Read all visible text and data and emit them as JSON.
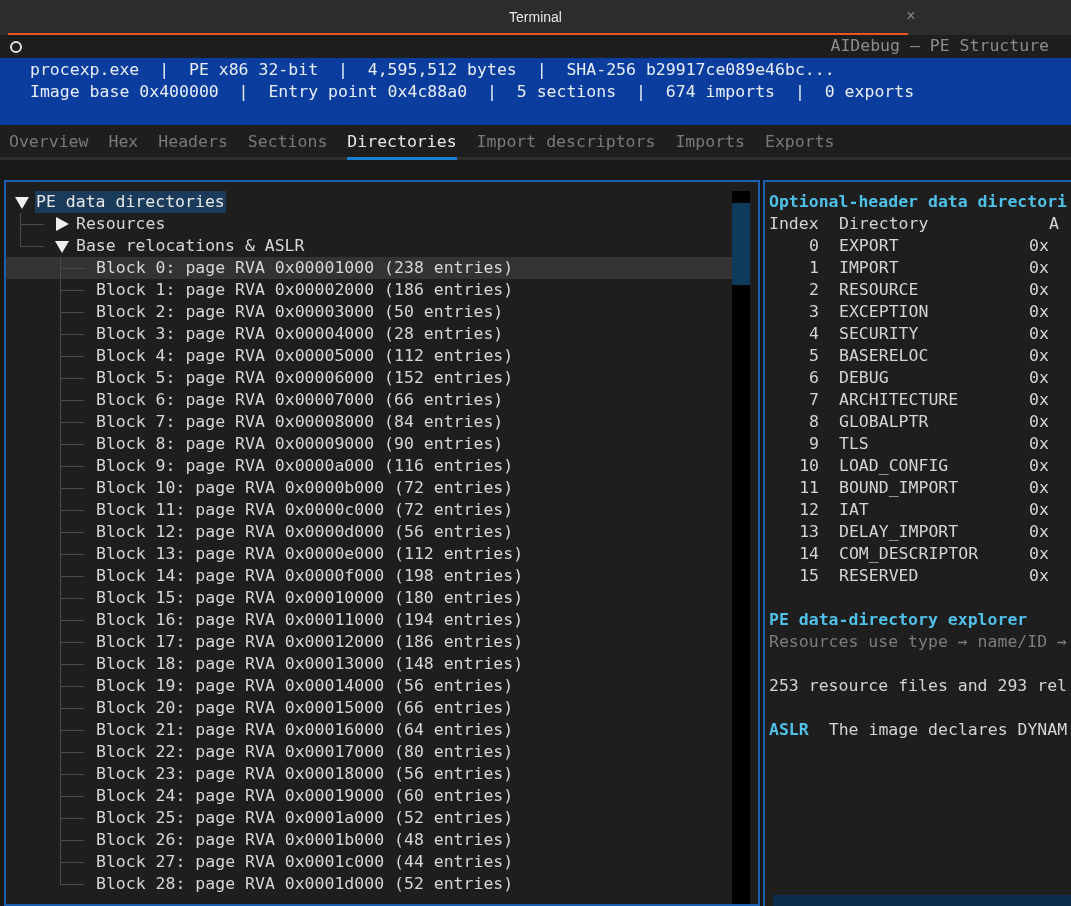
{
  "window": {
    "title": "Terminal",
    "close": "×"
  },
  "app_title": "AIDebug — PE Structure",
  "summary": [
    "procexp.exe  |  PE x86 32-bit  |  4,595,512 bytes  |  SHA-256 b29917ce089e46bc...",
    "Image base 0x400000  |  Entry point 0x4c88a0  |  5 sections  |  674 imports  |  0 exports"
  ],
  "tabs": [
    {
      "label": "Overview",
      "selected": false
    },
    {
      "label": "Hex",
      "selected": false
    },
    {
      "label": "Headers",
      "selected": false
    },
    {
      "label": "Sections",
      "selected": false
    },
    {
      "label": "Directories",
      "selected": true
    },
    {
      "label": "Import descriptors",
      "selected": false
    },
    {
      "label": "Imports",
      "selected": false
    },
    {
      "label": "Exports",
      "selected": false
    }
  ],
  "tree": {
    "label": "PE data directories",
    "expanded": true,
    "selected": true,
    "children": [
      {
        "label": "Resources",
        "expanded": false,
        "selected": false
      },
      {
        "label": "Base relocations & ASLR",
        "expanded": true,
        "selected": false,
        "children": [
          {
            "label": "Block 0: page RVA 0x00001000 (238 entries)",
            "selected": false,
            "hovered": true
          },
          {
            "label": "Block 1: page RVA 0x00002000 (186 entries)",
            "selected": false,
            "hovered": false
          },
          {
            "label": "Block 2: page RVA 0x00003000 (50 entries)",
            "selected": false,
            "hovered": false
          },
          {
            "label": "Block 3: page RVA 0x00004000 (28 entries)",
            "selected": false,
            "hovered": false
          },
          {
            "label": "Block 4: page RVA 0x00005000 (112 entries)",
            "selected": false,
            "hovered": false
          },
          {
            "label": "Block 5: page RVA 0x00006000 (152 entries)",
            "selected": false,
            "hovered": false
          },
          {
            "label": "Block 6: page RVA 0x00007000 (66 entries)",
            "selected": false,
            "hovered": false
          },
          {
            "label": "Block 7: page RVA 0x00008000 (84 entries)",
            "selected": false,
            "hovered": false
          },
          {
            "label": "Block 8: page RVA 0x00009000 (90 entries)",
            "selected": false,
            "hovered": false
          },
          {
            "label": "Block 9: page RVA 0x0000a000 (116 entries)",
            "selected": false,
            "hovered": false
          },
          {
            "label": "Block 10: page RVA 0x0000b000 (72 entries)",
            "selected": false,
            "hovered": false
          },
          {
            "label": "Block 11: page RVA 0x0000c000 (72 entries)",
            "selected": false,
            "hovered": false
          },
          {
            "label": "Block 12: page RVA 0x0000d000 (56 entries)",
            "selected": false,
            "hovered": false
          },
          {
            "label": "Block 13: page RVA 0x0000e000 (112 entries)",
            "selected": false,
            "hovered": false
          },
          {
            "label": "Block 14: page RVA 0x0000f000 (198 entries)",
            "selected": false,
            "hovered": false
          },
          {
            "label": "Block 15: page RVA 0x00010000 (180 entries)",
            "selected": false,
            "hovered": false
          },
          {
            "label": "Block 16: page RVA 0x00011000 (194 entries)",
            "selected": false,
            "hovered": false
          },
          {
            "label": "Block 17: page RVA 0x00012000 (186 entries)",
            "selected": false,
            "hovered": false
          },
          {
            "label": "Block 18: page RVA 0x00013000 (148 entries)",
            "selected": false,
            "hovered": false
          },
          {
            "label": "Block 19: page RVA 0x00014000 (56 entries)",
            "selected": false,
            "hovered": false
          },
          {
            "label": "Block 20: page RVA 0x00015000 (66 entries)",
            "selected": false,
            "hovered": false
          },
          {
            "label": "Block 21: page RVA 0x00016000 (64 entries)",
            "selected": false,
            "hovered": false
          },
          {
            "label": "Block 22: page RVA 0x00017000 (80 entries)",
            "selected": false,
            "hovered": false
          },
          {
            "label": "Block 23: page RVA 0x00018000 (56 entries)",
            "selected": false,
            "hovered": false
          },
          {
            "label": "Block 24: page RVA 0x00019000 (60 entries)",
            "selected": false,
            "hovered": false
          },
          {
            "label": "Block 25: page RVA 0x0001a000 (52 entries)",
            "selected": false,
            "hovered": false
          },
          {
            "label": "Block 26: page RVA 0x0001b000 (48 entries)",
            "selected": false,
            "hovered": false
          },
          {
            "label": "Block 27: page RVA 0x0001c000 (44 entries)",
            "selected": false,
            "hovered": false
          },
          {
            "label": "Block 28: page RVA 0x0001d000 (52 entries)",
            "selected": false,
            "hovered": false
          }
        ]
      }
    ]
  },
  "directories": {
    "title": "Optional-header data directori",
    "columns": [
      "Index",
      "Directory",
      "A"
    ],
    "rows": [
      {
        "index": "0",
        "name": "EXPORT",
        "address": "0x"
      },
      {
        "index": "1",
        "name": "IMPORT",
        "address": "0x"
      },
      {
        "index": "2",
        "name": "RESOURCE",
        "address": "0x"
      },
      {
        "index": "3",
        "name": "EXCEPTION",
        "address": "0x"
      },
      {
        "index": "4",
        "name": "SECURITY",
        "address": "0x"
      },
      {
        "index": "5",
        "name": "BASERELOC",
        "address": "0x"
      },
      {
        "index": "6",
        "name": "DEBUG",
        "address": "0x"
      },
      {
        "index": "7",
        "name": "ARCHITECTURE",
        "address": "0x"
      },
      {
        "index": "8",
        "name": "GLOBALPTR",
        "address": "0x"
      },
      {
        "index": "9",
        "name": "TLS",
        "address": "0x"
      },
      {
        "index": "10",
        "name": "LOAD_CONFIG",
        "address": "0x"
      },
      {
        "index": "11",
        "name": "BOUND_IMPORT",
        "address": "0x"
      },
      {
        "index": "12",
        "name": "IAT",
        "address": "0x"
      },
      {
        "index": "13",
        "name": "DELAY_IMPORT",
        "address": "0x"
      },
      {
        "index": "14",
        "name": "COM_DESCRIPTOR",
        "address": "0x"
      },
      {
        "index": "15",
        "name": "RESERVED",
        "address": "0x"
      }
    ]
  },
  "explorer": {
    "title": "PE data-directory explorer",
    "hint": "Resources use type → name/ID →",
    "summary": "253 resource files and 293 rel",
    "aslr_label": "ASLR",
    "aslr_text": "The image declares DYNAM"
  }
}
